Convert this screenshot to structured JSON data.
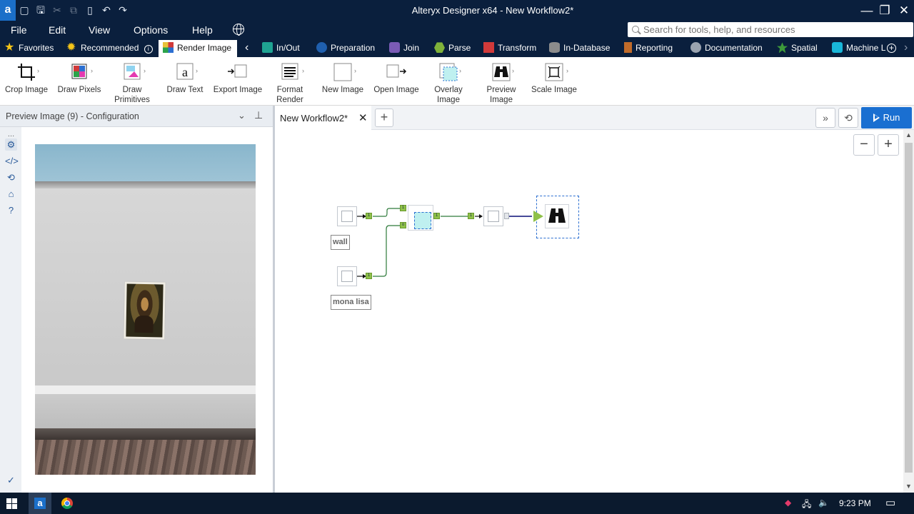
{
  "app": {
    "logo": "a",
    "title": "Alteryx Designer x64 - New Workflow2*"
  },
  "menu": {
    "items": [
      "File",
      "Edit",
      "View",
      "Options",
      "Help"
    ]
  },
  "search": {
    "placeholder": "Search for tools, help, and resources"
  },
  "categories": {
    "favorites": "Favorites",
    "recommended": "Recommended",
    "active": "Render Image",
    "items": [
      "In/Out",
      "Preparation",
      "Join",
      "Parse",
      "Transform",
      "In-Database",
      "Reporting",
      "Documentation",
      "Spatial",
      "Machine L"
    ],
    "colors": {
      "inout": "#1fa392",
      "preparation": "#1f5fae",
      "join": "#7a5bb5",
      "parse": "#7fb23a",
      "transform": "#d13a3a",
      "indatabase": "#8c8c8c",
      "reporting": "#c06b2a",
      "documentation": "#9aa4b0",
      "spatial": "#3d9a3a",
      "machine": "#19b6d8"
    }
  },
  "tools": [
    {
      "label": "Crop Image",
      "icon": "crop-icon"
    },
    {
      "label": "Draw Pixels",
      "icon": "pixels-icon"
    },
    {
      "label": "Draw\nPrimitives",
      "icon": "primitives-icon"
    },
    {
      "label": "Draw Text",
      "icon": "text-icon"
    },
    {
      "label": "Export Image",
      "icon": "export-icon"
    },
    {
      "label": "Format\nRender",
      "icon": "format-icon"
    },
    {
      "label": "New Image",
      "icon": "new-image-icon"
    },
    {
      "label": "Open Image",
      "icon": "open-image-icon"
    },
    {
      "label": "Overlay\nImage",
      "icon": "overlay-icon"
    },
    {
      "label": "Preview\nImage",
      "icon": "binoculars-icon"
    },
    {
      "label": "Scale Image",
      "icon": "scale-icon"
    }
  ],
  "config": {
    "title": "Preview Image (9) - Configuration"
  },
  "workflow": {
    "tab_title": "New Workflow2*",
    "run_label": "Run",
    "nodes": {
      "wall_label": "wall",
      "mona_label": "mona lisa"
    }
  },
  "taskbar": {
    "time": "9:23 PM"
  }
}
